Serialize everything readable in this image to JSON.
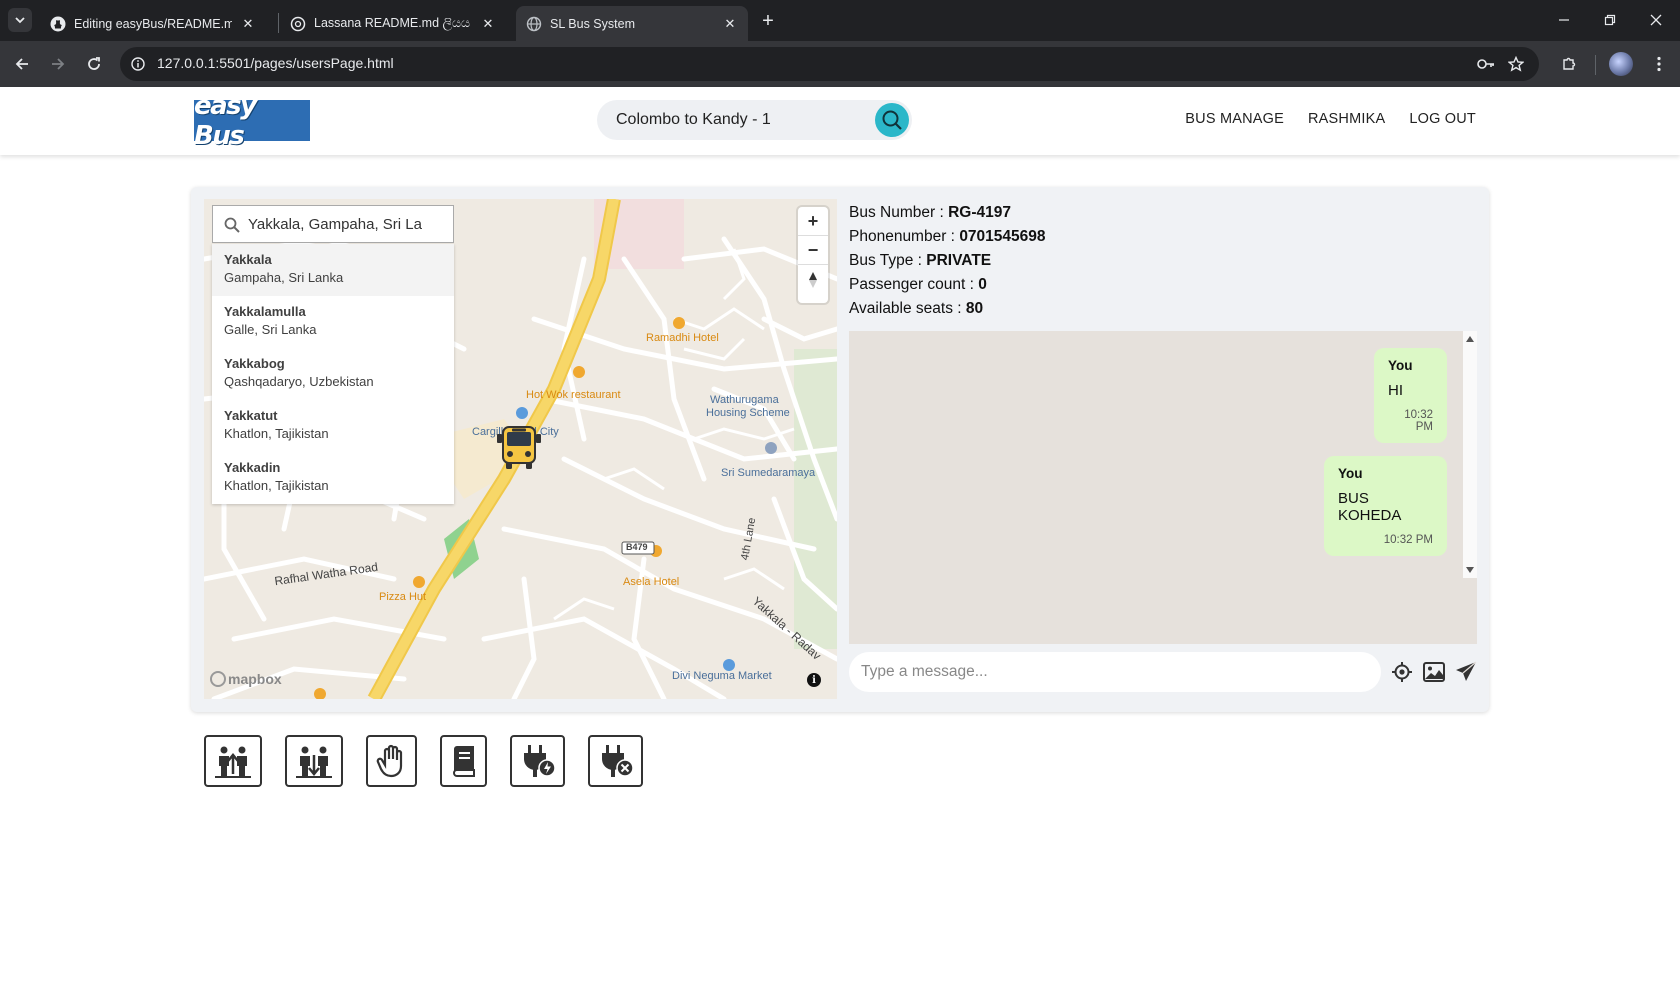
{
  "browser": {
    "tabs": [
      {
        "title": "Editing easyBus/README.md at",
        "active": false
      },
      {
        "title": "Lassana README.md ලියය",
        "active": false
      },
      {
        "title": "SL Bus System",
        "active": true
      }
    ],
    "url": "127.0.0.1:5501/pages/usersPage.html"
  },
  "header": {
    "logo_text": "easy Bus",
    "route_search_value": "Colombo to Kandy - 1",
    "nav": {
      "bus_manage": "BUS MANAGE",
      "user": "RASHMIKA",
      "logout": "LOG OUT"
    }
  },
  "map": {
    "search_value": "Yakkala, Gampaha, Sri La",
    "suggestions": [
      {
        "name": "Yakkala",
        "place": "Gampaha, Sri Lanka"
      },
      {
        "name": "Yakkalamulla",
        "place": "Galle, Sri Lanka"
      },
      {
        "name": "Yakkabog",
        "place": "Qashqadaryo, Uzbekistan"
      },
      {
        "name": "Yakkatut",
        "place": "Khatlon, Tajikistan"
      },
      {
        "name": "Yakkadin",
        "place": "Khatlon, Tajikistan"
      }
    ],
    "labels": {
      "ramadhi": "Ramadhi Hotel",
      "hotwok": "Hot Wok restaurant",
      "wathurugama1": "Wathurugama",
      "wathurugama2": "Housing Scheme",
      "cargills": "Cargills Food City",
      "sumedaramaya": "Sri Sumedaramaya",
      "b479": "B479",
      "lane4": "4th Lane",
      "rafhal": "Rafhal Watha Road",
      "pizzahut": "Pizza Hut",
      "asela": "Asela Hotel",
      "yakkala_road": "Yakkala - Radav",
      "divi": "Divi Neguma Market"
    },
    "attribution": "mapbox",
    "zoom_in": "+",
    "zoom_out": "−"
  },
  "bus": {
    "number_label": "Bus Number :",
    "number": "RG-4197",
    "phone_label": "Phonenumber :",
    "phone": "0701545698",
    "type_label": "Bus Type :",
    "type": "PRIVATE",
    "passengers_label": "Passenger count :",
    "passengers": "0",
    "seats_label": "Available seats :",
    "seats": "80"
  },
  "chat": {
    "messages": [
      {
        "sender": "You",
        "text": "HI",
        "time": "10:32 PM"
      },
      {
        "sender": "You",
        "text": "BUS KOHEDA",
        "time": "10:32 PM"
      }
    ],
    "input_placeholder": "Type a message..."
  },
  "colors": {
    "brand_blue": "#2d6db3",
    "search_teal": "#2bb7c9",
    "bubble_green": "#dcf8c6",
    "road_yellow": "#f7d768"
  },
  "actions": [
    {
      "icon": "passenger-board-icon"
    },
    {
      "icon": "passenger-alight-icon"
    },
    {
      "icon": "stop-hand-icon"
    },
    {
      "icon": "book-icon"
    },
    {
      "icon": "plug-charging-icon"
    },
    {
      "icon": "plug-disconnect-icon"
    }
  ]
}
